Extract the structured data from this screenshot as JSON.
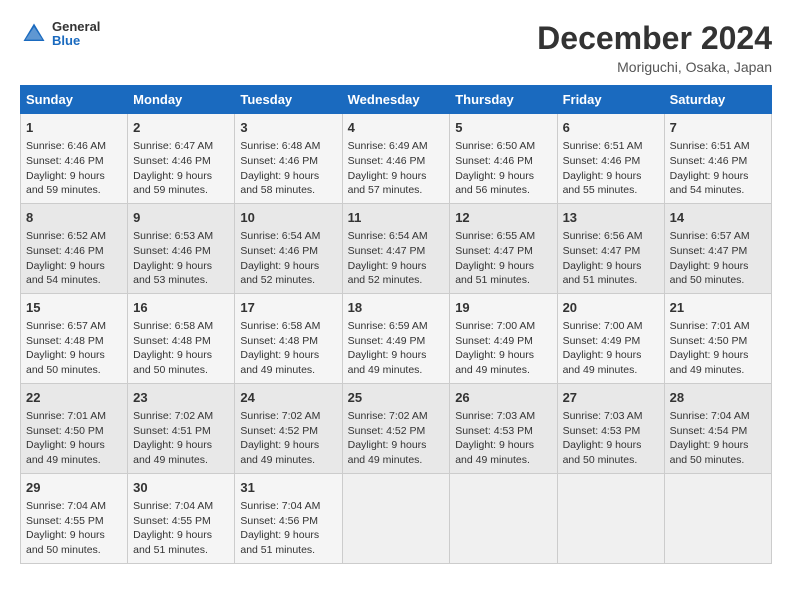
{
  "header": {
    "logo_general": "General",
    "logo_blue": "Blue",
    "title": "December 2024",
    "subtitle": "Moriguchi, Osaka, Japan"
  },
  "days_of_week": [
    "Sunday",
    "Monday",
    "Tuesday",
    "Wednesday",
    "Thursday",
    "Friday",
    "Saturday"
  ],
  "weeks": [
    [
      {
        "day": "1",
        "info": "Sunrise: 6:46 AM\nSunset: 4:46 PM\nDaylight: 9 hours\nand 59 minutes."
      },
      {
        "day": "2",
        "info": "Sunrise: 6:47 AM\nSunset: 4:46 PM\nDaylight: 9 hours\nand 59 minutes."
      },
      {
        "day": "3",
        "info": "Sunrise: 6:48 AM\nSunset: 4:46 PM\nDaylight: 9 hours\nand 58 minutes."
      },
      {
        "day": "4",
        "info": "Sunrise: 6:49 AM\nSunset: 4:46 PM\nDaylight: 9 hours\nand 57 minutes."
      },
      {
        "day": "5",
        "info": "Sunrise: 6:50 AM\nSunset: 4:46 PM\nDaylight: 9 hours\nand 56 minutes."
      },
      {
        "day": "6",
        "info": "Sunrise: 6:51 AM\nSunset: 4:46 PM\nDaylight: 9 hours\nand 55 minutes."
      },
      {
        "day": "7",
        "info": "Sunrise: 6:51 AM\nSunset: 4:46 PM\nDaylight: 9 hours\nand 54 minutes."
      }
    ],
    [
      {
        "day": "8",
        "info": "Sunrise: 6:52 AM\nSunset: 4:46 PM\nDaylight: 9 hours\nand 54 minutes."
      },
      {
        "day": "9",
        "info": "Sunrise: 6:53 AM\nSunset: 4:46 PM\nDaylight: 9 hours\nand 53 minutes."
      },
      {
        "day": "10",
        "info": "Sunrise: 6:54 AM\nSunset: 4:46 PM\nDaylight: 9 hours\nand 52 minutes."
      },
      {
        "day": "11",
        "info": "Sunrise: 6:54 AM\nSunset: 4:47 PM\nDaylight: 9 hours\nand 52 minutes."
      },
      {
        "day": "12",
        "info": "Sunrise: 6:55 AM\nSunset: 4:47 PM\nDaylight: 9 hours\nand 51 minutes."
      },
      {
        "day": "13",
        "info": "Sunrise: 6:56 AM\nSunset: 4:47 PM\nDaylight: 9 hours\nand 51 minutes."
      },
      {
        "day": "14",
        "info": "Sunrise: 6:57 AM\nSunset: 4:47 PM\nDaylight: 9 hours\nand 50 minutes."
      }
    ],
    [
      {
        "day": "15",
        "info": "Sunrise: 6:57 AM\nSunset: 4:48 PM\nDaylight: 9 hours\nand 50 minutes."
      },
      {
        "day": "16",
        "info": "Sunrise: 6:58 AM\nSunset: 4:48 PM\nDaylight: 9 hours\nand 50 minutes."
      },
      {
        "day": "17",
        "info": "Sunrise: 6:58 AM\nSunset: 4:48 PM\nDaylight: 9 hours\nand 49 minutes."
      },
      {
        "day": "18",
        "info": "Sunrise: 6:59 AM\nSunset: 4:49 PM\nDaylight: 9 hours\nand 49 minutes."
      },
      {
        "day": "19",
        "info": "Sunrise: 7:00 AM\nSunset: 4:49 PM\nDaylight: 9 hours\nand 49 minutes."
      },
      {
        "day": "20",
        "info": "Sunrise: 7:00 AM\nSunset: 4:49 PM\nDaylight: 9 hours\nand 49 minutes."
      },
      {
        "day": "21",
        "info": "Sunrise: 7:01 AM\nSunset: 4:50 PM\nDaylight: 9 hours\nand 49 minutes."
      }
    ],
    [
      {
        "day": "22",
        "info": "Sunrise: 7:01 AM\nSunset: 4:50 PM\nDaylight: 9 hours\nand 49 minutes."
      },
      {
        "day": "23",
        "info": "Sunrise: 7:02 AM\nSunset: 4:51 PM\nDaylight: 9 hours\nand 49 minutes."
      },
      {
        "day": "24",
        "info": "Sunrise: 7:02 AM\nSunset: 4:52 PM\nDaylight: 9 hours\nand 49 minutes."
      },
      {
        "day": "25",
        "info": "Sunrise: 7:02 AM\nSunset: 4:52 PM\nDaylight: 9 hours\nand 49 minutes."
      },
      {
        "day": "26",
        "info": "Sunrise: 7:03 AM\nSunset: 4:53 PM\nDaylight: 9 hours\nand 49 minutes."
      },
      {
        "day": "27",
        "info": "Sunrise: 7:03 AM\nSunset: 4:53 PM\nDaylight: 9 hours\nand 50 minutes."
      },
      {
        "day": "28",
        "info": "Sunrise: 7:04 AM\nSunset: 4:54 PM\nDaylight: 9 hours\nand 50 minutes."
      }
    ],
    [
      {
        "day": "29",
        "info": "Sunrise: 7:04 AM\nSunset: 4:55 PM\nDaylight: 9 hours\nand 50 minutes."
      },
      {
        "day": "30",
        "info": "Sunrise: 7:04 AM\nSunset: 4:55 PM\nDaylight: 9 hours\nand 51 minutes."
      },
      {
        "day": "31",
        "info": "Sunrise: 7:04 AM\nSunset: 4:56 PM\nDaylight: 9 hours\nand 51 minutes."
      },
      null,
      null,
      null,
      null
    ]
  ]
}
